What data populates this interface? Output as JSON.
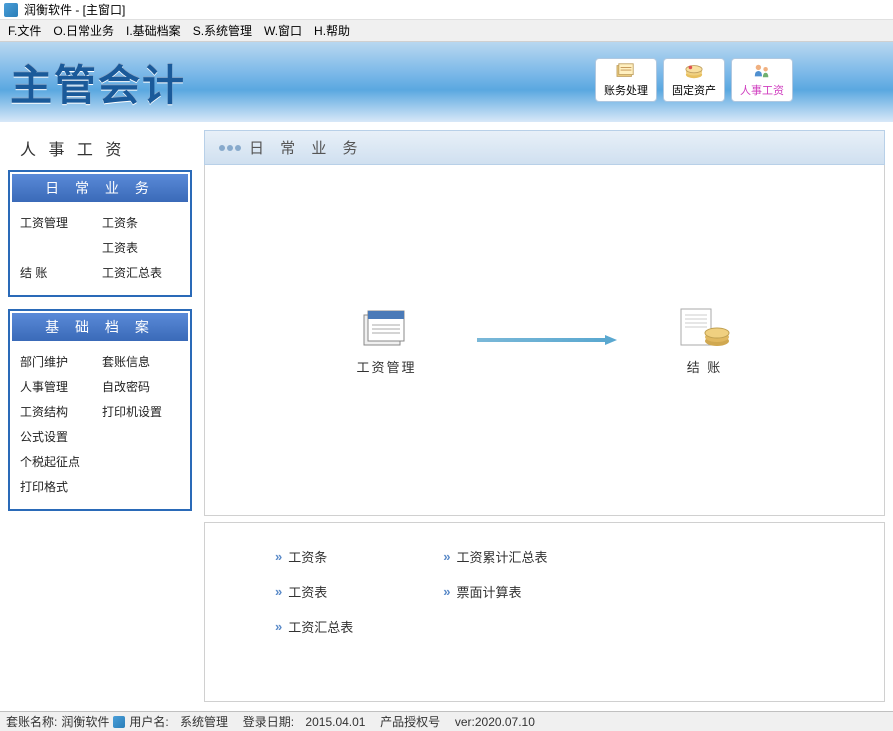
{
  "window": {
    "title": "润衡软件 - [主窗口]"
  },
  "menu": {
    "items": [
      "F.文件",
      "O.日常业务",
      "I.基础档案",
      "S.系统管理",
      "W.窗口",
      "H.帮助"
    ]
  },
  "banner": {
    "title": "主管会计",
    "buttons": [
      {
        "label": "账务处理",
        "active": false
      },
      {
        "label": "固定资产",
        "active": false
      },
      {
        "label": "人事工资",
        "active": true
      }
    ]
  },
  "sidebar": {
    "title": "人 事 工 资",
    "sections": [
      {
        "header": "日 常 业 务",
        "items": [
          "工资管理",
          "工资条",
          "",
          "工资表",
          "结 账",
          "工资汇总表"
        ]
      },
      {
        "header": "基 础 档 案",
        "items_col1": [
          "部门维护",
          "人事管理",
          "工资结构",
          "公式设置",
          "个税起征点",
          "打印格式"
        ],
        "items_col2": [
          "套账信息",
          "自改密码",
          "打印机设置"
        ]
      }
    ]
  },
  "content": {
    "header": "日 常 业 务",
    "flow": {
      "left": "工资管理",
      "right": "结 账"
    },
    "links_col1": [
      "工资条",
      "工资表",
      "工资汇总表"
    ],
    "links_col2": [
      "工资累计汇总表",
      "票面计算表"
    ]
  },
  "statusbar": {
    "account_label": "套账名称:",
    "account_value": "润衡软件",
    "user_label": "用户名:",
    "user_value": "系统管理",
    "date_label": "登录日期:",
    "date_value": "2015.04.01",
    "license_label": "产品授权号",
    "license_value": "ver:2020.07.10"
  }
}
